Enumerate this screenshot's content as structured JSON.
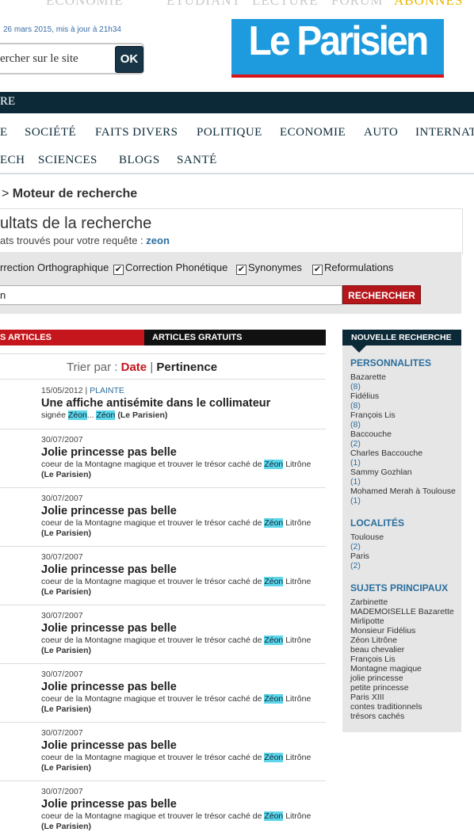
{
  "topnav": {
    "items": [
      "ECONOMIE",
      "ETUDIANT",
      "LECTURE",
      "FORUM"
    ],
    "abonnes": "ABONNES"
  },
  "header": {
    "date": "26 mars 2015, mis à jour à 21h34",
    "search_placeholder": "ercher sur le site",
    "ok_label": "OK",
    "logo": "Le Parisien"
  },
  "darknav": {
    "item": "RE"
  },
  "nav": {
    "row1": [
      "E",
      "SOCIÉTÉ",
      "FAITS DIVERS",
      "POLITIQUE",
      "ECONOMIE",
      "AUTO",
      "INTERNAT"
    ],
    "row2": [
      "ECH",
      "SCIENCES",
      "BLOGS",
      "SANTÉ"
    ]
  },
  "breadcrumb": {
    "sep": ">",
    "current": "Moteur de recherche"
  },
  "results_header": {
    "title": "ultats de la recherche",
    "count_text": "ats trouvés pour votre requête :",
    "query": "zeon"
  },
  "options": {
    "items": [
      "rrection Orthographique",
      "Correction Phonétique",
      "Synonymes",
      "Reformulations"
    ],
    "input_value": "n",
    "button": "RECHERCHER"
  },
  "tabs": {
    "active": "S ARTICLES",
    "other": "ARTICLES GRATUITS"
  },
  "sort": {
    "label": "Trier par :",
    "date": "Date",
    "sep": "|",
    "pertinence": "Pertinence"
  },
  "results": [
    {
      "date": "15/05/2012",
      "sep": " | ",
      "category": "PLAINTE",
      "title": "Une affiche antisémite dans le collimateur",
      "pre": "signée ",
      "hl": "Zéon",
      "mid": "... ",
      "hl2": "Zéon",
      "post": " ",
      "source": "(Le Parisien)"
    },
    {
      "date": "30/07/2007",
      "sep": "",
      "category": "",
      "title": "Jolie princesse pas belle",
      "pre": "coeur de la Montagne magique et trouver le trésor caché de ",
      "hl": "Zéon",
      "mid": "",
      "hl2": "",
      "post": " Litrône",
      "source": "(Le Parisien)"
    },
    {
      "date": "30/07/2007",
      "sep": "",
      "category": "",
      "title": "Jolie princesse pas belle",
      "pre": "coeur de la Montagne magique et trouver le trésor caché de ",
      "hl": "Zéon",
      "mid": "",
      "hl2": "",
      "post": " Litrône",
      "source": "(Le Parisien)"
    },
    {
      "date": "30/07/2007",
      "sep": "",
      "category": "",
      "title": "Jolie princesse pas belle",
      "pre": "coeur de la Montagne magique et trouver le trésor caché de ",
      "hl": "Zéon",
      "mid": "",
      "hl2": "",
      "post": " Litrône",
      "source": "(Le Parisien)"
    },
    {
      "date": "30/07/2007",
      "sep": "",
      "category": "",
      "title": "Jolie princesse pas belle",
      "pre": "coeur de la Montagne magique et trouver le trésor caché de ",
      "hl": "Zéon",
      "mid": "",
      "hl2": "",
      "post": " Litrône",
      "source": "(Le Parisien)"
    },
    {
      "date": "30/07/2007",
      "sep": "",
      "category": "",
      "title": "Jolie princesse pas belle",
      "pre": "coeur de la Montagne magique et trouver le trésor caché de ",
      "hl": "Zéon",
      "mid": "",
      "hl2": "",
      "post": " Litrône",
      "source": "(Le Parisien)"
    },
    {
      "date": "30/07/2007",
      "sep": "",
      "category": "",
      "title": "Jolie princesse pas belle",
      "pre": "coeur de la Montagne magique et trouver le trésor caché de ",
      "hl": "Zéon",
      "mid": "",
      "hl2": "",
      "post": " Litrône",
      "source": "(Le Parisien)"
    },
    {
      "date": "30/07/2007",
      "sep": "",
      "category": "",
      "title": "Jolie princesse pas belle",
      "pre": "coeur de la Montagne magique et trouver le trésor caché de ",
      "hl": "Zéon",
      "mid": "",
      "hl2": "",
      "post": " Litrône",
      "source": "(Le Parisien)"
    }
  ],
  "sidebar": {
    "header": "NOUVELLE RECHERCHE",
    "personnalites_title": "PERSONNALITES",
    "personnalites": [
      {
        "name": "Bazarette",
        "count": "(8)"
      },
      {
        "name": "Fidélius",
        "count": "(8)"
      },
      {
        "name": "François Lis",
        "count": "(8)"
      },
      {
        "name": "Baccouche",
        "count": "(2)"
      },
      {
        "name": "Charles Baccouche",
        "count": "(1)"
      },
      {
        "name": "Sammy Gozhlan",
        "count": "(1)"
      },
      {
        "name": "Mohamed Merah à Toulouse",
        "count": "(1)"
      }
    ],
    "localites_title": "LOCALITÉS",
    "localites": [
      {
        "name": "Toulouse",
        "count": "(2)"
      },
      {
        "name": "Paris",
        "count": "(2)"
      }
    ],
    "sujets_title": "SUJETS PRINCIPAUX",
    "sujets": [
      "Zarbinette",
      "MADEMOISELLE Bazarette",
      "Mirlipotte",
      "Monsieur Fidélius",
      "Zéon Litrône",
      "beau chevalier",
      "François Lis",
      "Montagne magique",
      "jolie princesse",
      "petite princesse",
      "Paris XIII",
      "contes traditionnels",
      "trésors cachés"
    ]
  },
  "colors": {
    "brand_blue": "#1e9bde",
    "dark_navy": "#0c2938",
    "red": "#c4161c",
    "highlight": "#5cd6ea"
  }
}
